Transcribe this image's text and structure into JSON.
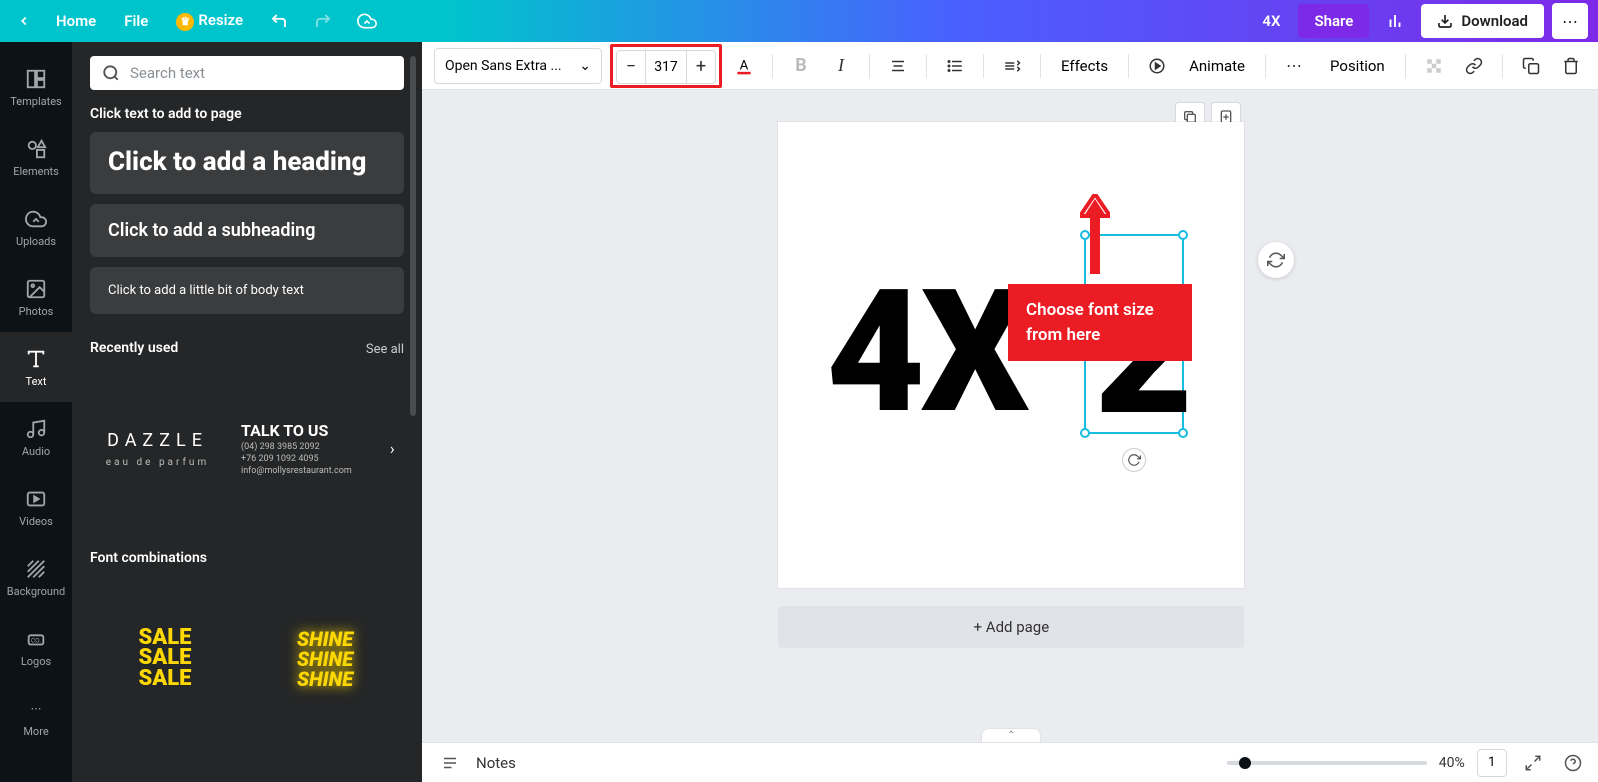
{
  "topbar": {
    "home": "Home",
    "file": "File",
    "resize": "Resize",
    "title": "4X",
    "share": "Share",
    "download": "Download"
  },
  "nav": {
    "templates": "Templates",
    "elements": "Elements",
    "uploads": "Uploads",
    "photos": "Photos",
    "text": "Text",
    "audio": "Audio",
    "videos": "Videos",
    "background": "Background",
    "logos": "Logos",
    "more": "More"
  },
  "panel": {
    "search_placeholder": "Search text",
    "click_add": "Click text to add to page",
    "heading": "Click to add a heading",
    "subheading": "Click to add a subheading",
    "body": "Click to add a little bit of body text",
    "recent": "Recently used",
    "see_all": "See all",
    "dazzle1": "DAZZLE",
    "dazzle2": "eau de parfum",
    "talk": "TALK TO US",
    "talk_l1": "(04) 298 3985 2092",
    "talk_l2": "+76 209 1092 4095",
    "talk_l3": "info@mollysrestaurant.com",
    "font_comb": "Font combinations",
    "sale": "SALE",
    "shine": "SHINE"
  },
  "toolbar": {
    "font": "Open Sans Extra ...",
    "size": "317",
    "effects": "Effects",
    "animate": "Animate",
    "position": "Position"
  },
  "canvas": {
    "text_4x": "4X",
    "text_2": "2",
    "add_page": "+ Add page"
  },
  "annotation": {
    "text": "Choose font size from here"
  },
  "bottom": {
    "notes": "Notes",
    "zoom": "40%",
    "page": "1"
  }
}
